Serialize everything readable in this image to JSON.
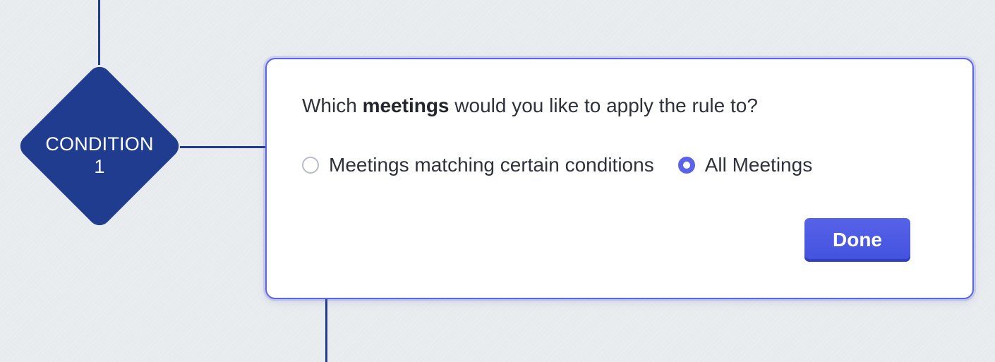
{
  "flow": {
    "condition_node": {
      "label_line_1": "CONDITION",
      "label_line_2": "1"
    }
  },
  "popup": {
    "question": {
      "prefix": "Which ",
      "emphasis": "meetings",
      "suffix": " would you like to apply the rule to?"
    },
    "options": [
      {
        "label": "Meetings matching certain conditions",
        "selected": false
      },
      {
        "label": "All Meetings",
        "selected": true
      }
    ],
    "done_label": "Done"
  },
  "colors": {
    "node": "#1f3c8f",
    "accent": "#5b63e8",
    "background": "#e9ecef"
  }
}
